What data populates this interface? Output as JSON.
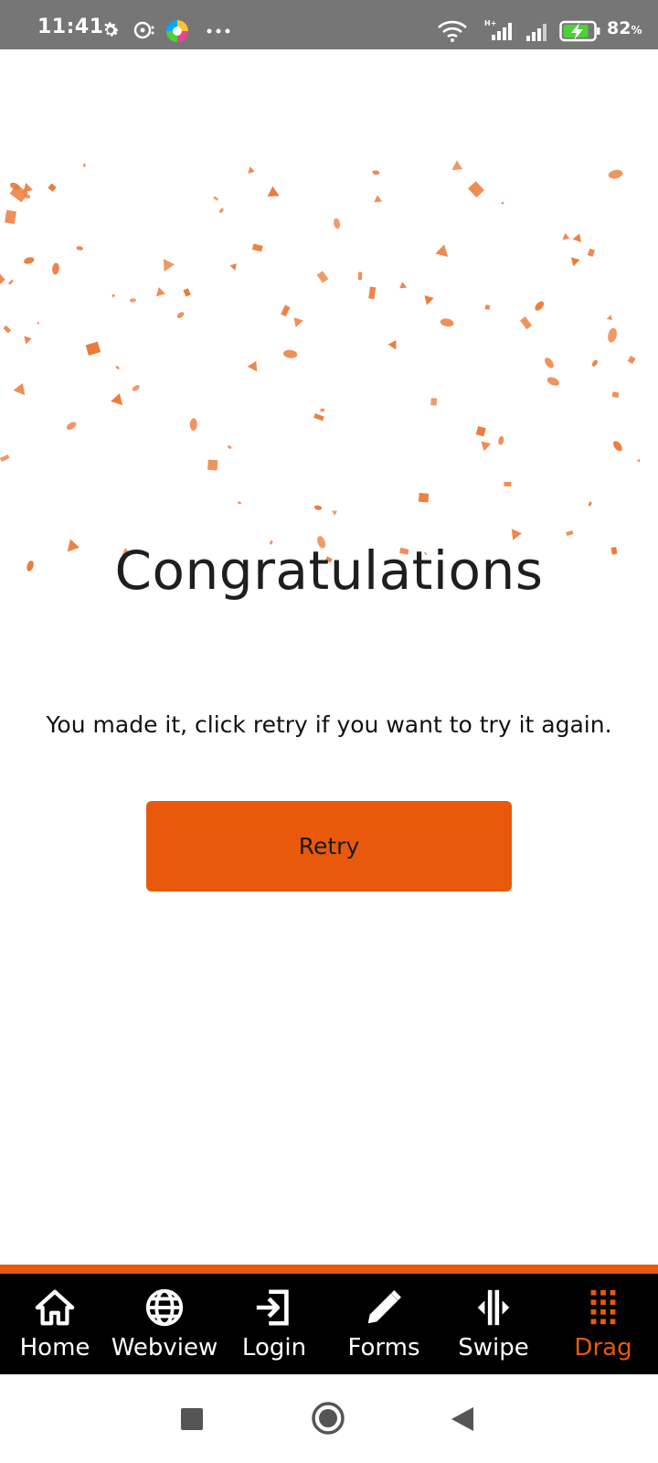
{
  "status_bar": {
    "time": "11:41",
    "battery_percent": "82",
    "battery_unit": "%",
    "icons": [
      "settings-icon",
      "media-icon",
      "app-icon",
      "more-dots-icon",
      "wifi-icon",
      "signal-icon",
      "signal-icon-2",
      "battery-charging-icon"
    ]
  },
  "main": {
    "title": "Congratulations",
    "message": "You made it, click retry if you want to try it again.",
    "retry_label": "Retry"
  },
  "colors": {
    "accent": "#e8590c",
    "confetti": "#ec7a3a",
    "statusbar": "#767676",
    "tabbar": "#000000"
  },
  "tabs": [
    {
      "label": "Home",
      "icon": "home-icon",
      "active": false
    },
    {
      "label": "Webview",
      "icon": "globe-icon",
      "active": false
    },
    {
      "label": "Login",
      "icon": "login-icon",
      "active": false
    },
    {
      "label": "Forms",
      "icon": "pencil-icon",
      "active": false
    },
    {
      "label": "Swipe",
      "icon": "swipe-icon",
      "active": false
    },
    {
      "label": "Drag",
      "icon": "drag-grid-icon",
      "active": true
    }
  ],
  "system_nav": [
    "recents-button",
    "home-button",
    "back-button"
  ]
}
